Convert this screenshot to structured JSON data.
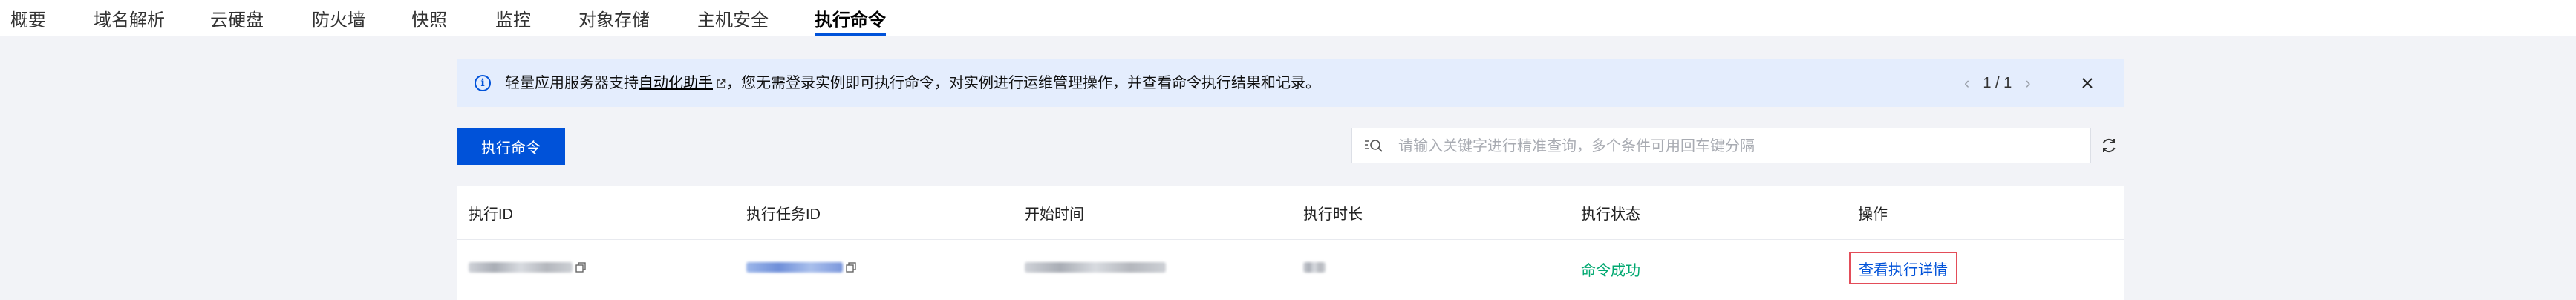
{
  "tabs": [
    {
      "label": "概要"
    },
    {
      "label": "域名解析"
    },
    {
      "label": "云硬盘"
    },
    {
      "label": "防火墙"
    },
    {
      "label": "快照"
    },
    {
      "label": "监控"
    },
    {
      "label": "对象存储"
    },
    {
      "label": "主机安全"
    },
    {
      "label": "执行命令",
      "active": true
    }
  ],
  "banner": {
    "text_prefix": "轻量应用服务器支持",
    "link_text": "自动化助手",
    "text_suffix": "，您无需登录实例即可执行命令，对实例进行运维管理操作，并查看命令执行结果和记录。",
    "page_current": "1",
    "page_sep": "/",
    "page_total": "1"
  },
  "toolbar": {
    "run_button_label": "执行命令",
    "search_placeholder": "请输入关键字进行精准查询，多个条件可用回车键分隔"
  },
  "table": {
    "columns": [
      "执行ID",
      "执行任务ID",
      "开始时间",
      "执行时长",
      "执行状态",
      "操作"
    ],
    "rows": [
      {
        "status": "命令成功",
        "action": "查看执行详情"
      }
    ]
  },
  "colors": {
    "accent": "#0052d9",
    "success": "#00a870",
    "highlight_border": "#e34d59",
    "banner_bg": "#e4edfd"
  },
  "icons": [
    "info-icon",
    "external-link-icon",
    "chevron-left-icon",
    "chevron-right-icon",
    "close-icon",
    "search-icon",
    "refresh-icon",
    "copy-icon"
  ]
}
